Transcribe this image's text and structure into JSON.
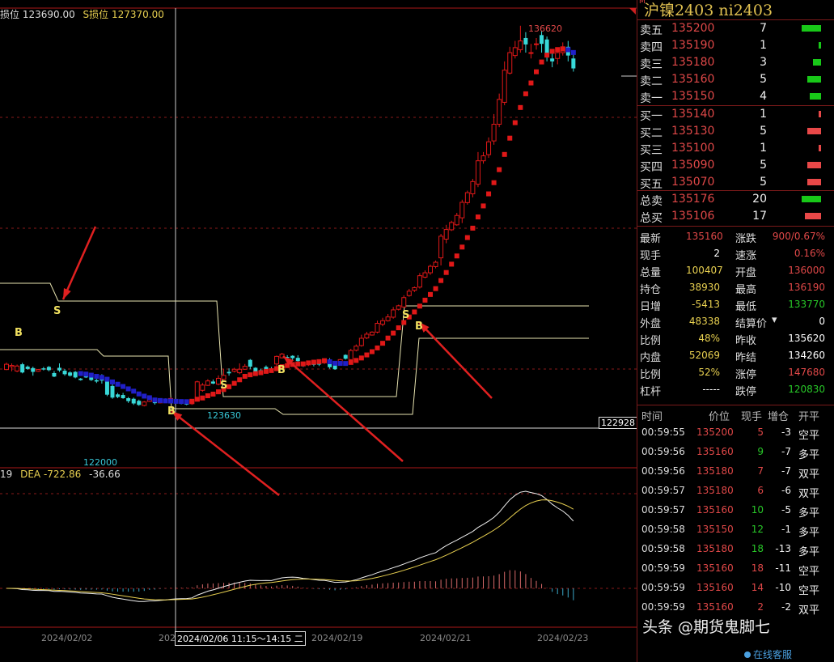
{
  "chart_header": {
    "stop_long": "损位 123690.00",
    "stop_short": "S损位 127370.00"
  },
  "macd_header": {
    "dif": "19",
    "dea": "DEA -722.86",
    "macd": "-36.66"
  },
  "price_marks": {
    "high": "136620",
    "low_a": "122000",
    "low_b": "123630",
    "right_tag": "122928"
  },
  "date_axis": {
    "labels": [
      "2024/02/02",
      "202",
      "2024/02/19",
      "2024/02/21",
      "2024/02/23"
    ],
    "cursor": "2024/02/06 11:15～14:15 二"
  },
  "signal_labels": {
    "buy": "B",
    "sell": "S"
  },
  "colors": {
    "up": "#e01818",
    "down": "#38d8d8",
    "bull_trend": "#e01818",
    "bear_trend": "#2020c8",
    "sell_bar": "#18c818",
    "buy_bar": "#e84848"
  },
  "chart_data": {
    "type": "candlestick",
    "title": "",
    "ylim": [
      121500,
      137500
    ],
    "candles": [
      [
        124860,
        125040,
        124840,
        125100
      ],
      [
        124960,
        125000,
        124800,
        125070
      ],
      [
        124810,
        124980,
        124770,
        125030
      ],
      [
        125040,
        124760,
        124730,
        125090
      ],
      [
        124960,
        124880,
        124850,
        125000
      ],
      [
        124910,
        124780,
        124650,
        124960
      ],
      [
        124800,
        124860,
        124780,
        124880
      ],
      [
        124900,
        124860,
        124830,
        124950
      ],
      [
        124950,
        124840,
        124800,
        124980
      ],
      [
        124740,
        124620,
        124600,
        124810
      ],
      [
        124920,
        124830,
        124780,
        125070
      ],
      [
        124820,
        124700,
        124650,
        124880
      ],
      [
        124760,
        124650,
        124620,
        124800
      ],
      [
        124780,
        124590,
        124560,
        124810
      ],
      [
        124550,
        124500,
        124480,
        124570
      ],
      [
        124740,
        124590,
        124570,
        124760
      ],
      [
        124640,
        124500,
        124470,
        124690
      ],
      [
        124500,
        124450,
        124400,
        124540
      ],
      [
        124640,
        124480,
        124380,
        124700
      ],
      [
        124500,
        124000,
        123950,
        124520
      ],
      [
        124300,
        123900,
        123860,
        124360
      ],
      [
        124010,
        123920,
        123880,
        124060
      ],
      [
        123990,
        123880,
        123860,
        124060
      ],
      [
        123880,
        123780,
        123720,
        123920
      ],
      [
        123860,
        123700,
        123650,
        123900
      ],
      [
        123790,
        123650,
        123620,
        123830
      ],
      [
        123630,
        123750,
        123600,
        123780
      ],
      [
        123770,
        123900,
        123750,
        123910
      ],
      [
        123790,
        123710,
        123660,
        123830
      ],
      [
        123720,
        123820,
        123700,
        123860
      ],
      [
        123830,
        123770,
        123740,
        123870
      ],
      [
        123800,
        123870,
        123770,
        123900
      ],
      [
        123820,
        123780,
        123760,
        123850
      ],
      [
        123800,
        123700,
        123670,
        123820
      ],
      [
        123770,
        123660,
        123640,
        123790
      ],
      [
        123690,
        123790,
        123650,
        123820
      ],
      [
        123790,
        124440,
        123780,
        124480
      ],
      [
        124150,
        124330,
        124100,
        124400
      ],
      [
        124320,
        124470,
        124300,
        124530
      ],
      [
        124450,
        124380,
        124360,
        124520
      ],
      [
        124360,
        124560,
        124320,
        124660
      ],
      [
        124530,
        124660,
        124500,
        124890
      ],
      [
        124780,
        124730,
        124650,
        124900
      ],
      [
        124800,
        124870,
        124760,
        124920
      ],
      [
        124750,
        124870,
        124700,
        125070
      ],
      [
        124870,
        124970,
        124850,
        125050
      ],
      [
        125190,
        124960,
        124870,
        125220
      ],
      [
        124920,
        124740,
        124700,
        124940
      ],
      [
        124840,
        124780,
        124760,
        124890
      ],
      [
        124950,
        124840,
        124810,
        125000
      ],
      [
        124900,
        124830,
        124800,
        124950
      ],
      [
        125050,
        125310,
        124960,
        125340
      ],
      [
        125260,
        125390,
        125240,
        125430
      ],
      [
        125290,
        125260,
        125220,
        125350
      ],
      [
        125330,
        125250,
        125180,
        125350
      ],
      [
        125260,
        125150,
        125120,
        125350
      ],
      [
        125060,
        124980,
        124950,
        125100
      ],
      [
        125030,
        125090,
        124980,
        125140
      ],
      [
        125080,
        125020,
        124970,
        125100
      ],
      [
        125070,
        125030,
        124980,
        125160
      ],
      [
        125090,
        125160,
        125050,
        125210
      ],
      [
        125200,
        124940,
        124890,
        125250
      ],
      [
        125080,
        124870,
        124850,
        125110
      ],
      [
        125050,
        125200,
        125020,
        125230
      ],
      [
        125360,
        125230,
        125200,
        125380
      ],
      [
        125200,
        125510,
        125140,
        125570
      ],
      [
        125520,
        125660,
        125480,
        125720
      ],
      [
        125680,
        125930,
        125640,
        126050
      ],
      [
        125940,
        126070,
        125900,
        126150
      ],
      [
        126040,
        126140,
        126020,
        126170
      ],
      [
        126140,
        126440,
        126100,
        126530
      ],
      [
        126410,
        126530,
        126340,
        126630
      ],
      [
        126530,
        126660,
        126500,
        126760
      ],
      [
        126650,
        126900,
        126600,
        127000
      ],
      [
        126920,
        127040,
        126880,
        127080
      ],
      [
        127000,
        127320,
        126970,
        127400
      ],
      [
        127390,
        127540,
        127350,
        127620
      ],
      [
        127570,
        127660,
        127510,
        127700
      ],
      [
        127680,
        128070,
        127630,
        128160
      ],
      [
        128020,
        128170,
        127980,
        128250
      ],
      [
        128170,
        128390,
        128100,
        128450
      ],
      [
        128380,
        128530,
        128320,
        128590
      ],
      [
        128680,
        129420,
        128420,
        129500
      ],
      [
        129320,
        129650,
        129180,
        129810
      ],
      [
        129640,
        129890,
        129600,
        129950
      ],
      [
        129810,
        130130,
        129780,
        130220
      ],
      [
        130050,
        130580,
        129870,
        130670
      ],
      [
        130570,
        130910,
        130500,
        130980
      ],
      [
        130870,
        131290,
        130750,
        131380
      ],
      [
        131200,
        132000,
        131100,
        132300
      ],
      [
        132000,
        132170,
        131900,
        132300
      ],
      [
        132210,
        132650,
        132100,
        132800
      ],
      [
        132680,
        133250,
        132550,
        133600
      ],
      [
        133250,
        134100,
        133150,
        134300
      ],
      [
        134000,
        135100,
        133900,
        135400
      ],
      [
        135000,
        135700,
        134950,
        135900
      ],
      [
        135600,
        135870,
        135500,
        136100
      ],
      [
        135800,
        136100,
        135700,
        136620
      ],
      [
        136200,
        135980,
        135700,
        136400
      ],
      [
        135700,
        135700,
        135500,
        136000
      ],
      [
        136000,
        136000,
        135800,
        136200
      ],
      [
        136300,
        136000,
        135700,
        136450
      ],
      [
        136150,
        135600,
        135400,
        136250
      ],
      [
        135500,
        135400,
        135200,
        135700
      ],
      [
        135500,
        135700,
        135300,
        135800
      ],
      [
        135700,
        135900,
        135600,
        136050
      ],
      [
        135900,
        135600,
        135400,
        136100
      ],
      [
        135500,
        135160,
        135050,
        135700
      ]
    ]
  },
  "order_book": {
    "asks": [
      {
        "label": "卖五",
        "price": "135200",
        "qty": "7",
        "size": 7
      },
      {
        "label": "卖四",
        "price": "135190",
        "qty": "1",
        "size": 1
      },
      {
        "label": "卖三",
        "price": "135180",
        "qty": "3",
        "size": 3
      },
      {
        "label": "卖二",
        "price": "135160",
        "qty": "5",
        "size": 5
      },
      {
        "label": "卖一",
        "price": "135150",
        "qty": "4",
        "size": 4
      }
    ],
    "bids": [
      {
        "label": "买一",
        "price": "135140",
        "qty": "1",
        "size": 1
      },
      {
        "label": "买二",
        "price": "135130",
        "qty": "5",
        "size": 5
      },
      {
        "label": "买三",
        "price": "135100",
        "qty": "1",
        "size": 1
      },
      {
        "label": "买四",
        "price": "135090",
        "qty": "5",
        "size": 5
      },
      {
        "label": "买五",
        "price": "135070",
        "qty": "5",
        "size": 5
      }
    ],
    "totals": [
      {
        "label": "总卖",
        "price": "135176",
        "qty": "20",
        "size": 20
      },
      {
        "label": "总买",
        "price": "135106",
        "qty": "17",
        "size": 17
      }
    ]
  },
  "panel_title": "沪镍2403  ni2403",
  "panel_marker": "M",
  "stats": [
    {
      "l1": "最新",
      "v1": "135160",
      "c1": "#e04848",
      "l2": "涨跌",
      "v2": "900/0.67%",
      "c2": "#e04848"
    },
    {
      "l1": "现手",
      "v1": "2",
      "c1": "#ffffff",
      "l2": "速涨",
      "v2": "0.16%",
      "c2": "#e04848"
    },
    {
      "l1": "总量",
      "v1": "100407",
      "c1": "#e8d050",
      "l2": "开盘",
      "v2": "136000",
      "c2": "#e04848"
    },
    {
      "l1": "持仓",
      "v1": "38930",
      "c1": "#e8d050",
      "l2": "最高",
      "v2": "136190",
      "c2": "#e04848"
    },
    {
      "l1": "日增",
      "v1": "-5413",
      "c1": "#e8d050",
      "l2": "最低",
      "v2": "133770",
      "c2": "#28c828"
    },
    {
      "l1": "外盘",
      "v1": "48338",
      "c1": "#e8d050",
      "l2": "结算价",
      "v2": "0",
      "c2": "#ffffff"
    },
    {
      "l1": "比例",
      "v1": "48%",
      "c1": "#e8d050",
      "l2": "昨收",
      "v2": "135620",
      "c2": "#ffffff"
    },
    {
      "l1": "内盘",
      "v1": "52069",
      "c1": "#e8d050",
      "l2": "昨结",
      "v2": "134260",
      "c2": "#ffffff"
    },
    {
      "l1": "比例",
      "v1": "52%",
      "c1": "#e8d050",
      "l2": "涨停",
      "v2": "147680",
      "c2": "#e04848"
    },
    {
      "l1": "杠杆",
      "v1": "-----",
      "c1": "#ffffff",
      "l2": "跌停",
      "v2": "120830",
      "c2": "#28c828"
    }
  ],
  "ticks_header": {
    "time": "时间",
    "price": "价位",
    "hand": "现手",
    "oi": "增仓",
    "type": "开平"
  },
  "ticks": [
    {
      "time": "00:59:55",
      "price": "135200",
      "hand": "5",
      "oi": "-3",
      "type": "空平",
      "hc": "#e04848",
      "oc": "#f0f0f0"
    },
    {
      "time": "00:59:56",
      "price": "135160",
      "hand": "9",
      "oi": "-7",
      "type": "多平",
      "hc": "#28c828",
      "oc": "#f0f0f0"
    },
    {
      "time": "00:59:56",
      "price": "135180",
      "hand": "7",
      "oi": "-7",
      "type": "双平",
      "hc": "#e04848",
      "oc": "#f0f0f0"
    },
    {
      "time": "00:59:57",
      "price": "135180",
      "hand": "6",
      "oi": "-6",
      "type": "双平",
      "hc": "#e04848",
      "oc": "#f0f0f0"
    },
    {
      "time": "00:59:57",
      "price": "135160",
      "hand": "10",
      "oi": "-5",
      "type": "多平",
      "hc": "#28c828",
      "oc": "#f0f0f0"
    },
    {
      "time": "00:59:58",
      "price": "135150",
      "hand": "12",
      "oi": "-1",
      "type": "多平",
      "hc": "#28c828",
      "oc": "#f0f0f0"
    },
    {
      "time": "00:59:58",
      "price": "135180",
      "hand": "18",
      "oi": "-13",
      "type": "多平",
      "hc": "#28c828",
      "oc": "#f0f0f0"
    },
    {
      "time": "00:59:59",
      "price": "135160",
      "hand": "18",
      "oi": "-11",
      "type": "空平",
      "hc": "#e04848",
      "oc": "#f0f0f0"
    },
    {
      "time": "00:59:59",
      "price": "135160",
      "hand": "14",
      "oi": "-10",
      "type": "空平",
      "hc": "#e04848",
      "oc": "#f0f0f0"
    },
    {
      "time": "00:59:59",
      "price": "135160",
      "hand": "2",
      "oi": "-2",
      "type": "双平",
      "hc": "#e04848",
      "oc": "#f0f0f0"
    }
  ],
  "watermark": "头条 @期货鬼脚七",
  "footer_link": "在线客服"
}
